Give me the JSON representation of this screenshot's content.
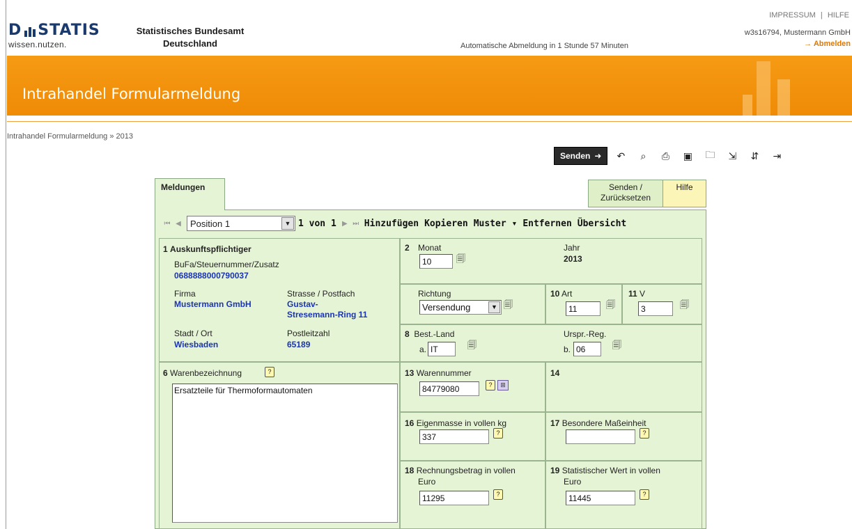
{
  "header": {
    "logo_word": "D STATIS",
    "logo_sub": "wissen.nutzen.",
    "org_line1": "Statistisches Bundesamt",
    "org_line2": "Deutschland",
    "nav_impressum": "IMPRESSUM",
    "nav_sep": "|",
    "nav_hilfe": "HILFE",
    "session_text": "Automatische Abmeldung in 1 Stunde 57 Minuten",
    "user_text": "w3s16794, Mustermann GmbH",
    "logout_label": "→ Abmelden"
  },
  "banner": {
    "title": "Intrahandel Formularmeldung",
    "color": "#f39410"
  },
  "breadcrumb": "Intrahandel Formularmeldung » 2013",
  "toolbar": {
    "send_label": "Senden",
    "icons": [
      "undo-icon",
      "search-icon",
      "print-preview-icon",
      "save-icon",
      "open-folder-icon",
      "export-icon",
      "import-icon",
      "logout-icon"
    ]
  },
  "tabs": {
    "meldungen": "Meldungen",
    "send_reset_1": "Senden /",
    "send_reset_2": "Zurücksetzen",
    "hilfe": "Hilfe"
  },
  "nav": {
    "position": "Position 1",
    "page": "1 von 1",
    "add": "Hinzufügen",
    "copy": "Kopieren",
    "template": "Muster ▾",
    "remove": "Entfernen",
    "overview": "Übersicht"
  },
  "form": {
    "f1_num": "1",
    "f1_title": "Auskunftspflichtiger",
    "taxid_label": "BuFa/Steuernummer/Zusatz",
    "taxid_value": "0688888000790037",
    "firma_label": "Firma",
    "firma_value": "Mustermann GmbH",
    "street_label": "Strasse / Postfach",
    "street_value1": "Gustav-",
    "street_value2": "Stresemann-Ring 11",
    "city_label": "Stadt / Ort",
    "city_value": "Wiesbaden",
    "zip_label": "Postleitzahl",
    "zip_value": "65189",
    "f2_num": "2",
    "monat_label": "Monat",
    "monat_value": "10",
    "jahr_label": "Jahr",
    "jahr_value": "2013",
    "richtung_label": "Richtung",
    "richtung_value": "Versendung",
    "f10_num": "10",
    "art_label": "Art",
    "art_value": "11",
    "f11_num": "11",
    "v_label": "V",
    "v_value": "3",
    "f8_num": "8",
    "bestland_label": "Best.-Land",
    "bestland_prefix": "a.",
    "bestland_value": "IT",
    "ursprreg_label": "Urspr.-Reg.",
    "ursprreg_prefix": "b.",
    "ursprreg_value": "06",
    "f6_num": "6",
    "waren_label": "Warenbezeichnung",
    "waren_value": "Ersatzteile für Thermoformautomaten",
    "f13_num": "13",
    "warennr_label": "Warennummer",
    "warennr_value": "84779080",
    "f14_num": "14",
    "f16_num": "16",
    "eigenmasse_label": "Eigenmasse in vollen kg",
    "eigenmasse_value": "337",
    "f17_num": "17",
    "besmass_label": "Besondere Maßeinheit",
    "besmass_value": "",
    "f18_num": "18",
    "rechnung_label": "Rechnungsbetrag in vollen",
    "rechnung_label2": "Euro",
    "rechnung_value": "11295",
    "f19_num": "19",
    "statwert_label": "Statistischer Wert in vollen",
    "statwert_label2": "Euro",
    "statwert_value": "11445"
  }
}
